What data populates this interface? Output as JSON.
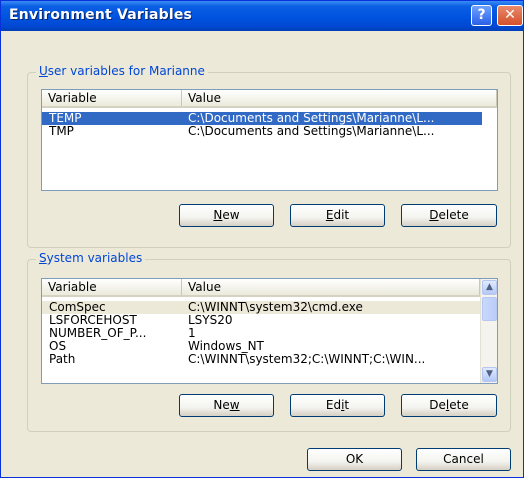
{
  "window": {
    "title": "Environment Variables",
    "help_glyph": "?",
    "close_glyph": "✕"
  },
  "user_group": {
    "label_prefix": "",
    "label_underline": "U",
    "label_rest": "ser variables for Marianne",
    "columns": [
      "Variable",
      "Value"
    ],
    "rows": [
      {
        "variable": "TEMP",
        "value": "C:\\Documents and Settings\\Marianne\\L..."
      },
      {
        "variable": "TMP",
        "value": "C:\\Documents and Settings\\Marianne\\L..."
      }
    ],
    "buttons": {
      "new": {
        "pre": "",
        "u": "N",
        "post": "ew"
      },
      "edit": {
        "pre": "",
        "u": "E",
        "post": "dit"
      },
      "delete": {
        "pre": "",
        "u": "D",
        "post": "elete"
      }
    }
  },
  "system_group": {
    "label_prefix": "",
    "label_underline": "S",
    "label_rest": "ystem variables",
    "columns": [
      "Variable",
      "Value"
    ],
    "rows": [
      {
        "variable": "ComSpec",
        "value": "C:\\WINNT\\system32\\cmd.exe"
      },
      {
        "variable": "LSFORCEHOST",
        "value": "LSYS20"
      },
      {
        "variable": "NUMBER_OF_P...",
        "value": "1"
      },
      {
        "variable": "OS",
        "value": "Windows_NT"
      },
      {
        "variable": "Path",
        "value": "C:\\WINNT\\system32;C:\\WINNT;C:\\WIN..."
      }
    ],
    "buttons": {
      "new": {
        "pre": "Ne",
        "u": "w",
        "post": ""
      },
      "edit": {
        "pre": "Ed",
        "u": "i",
        "post": "t"
      },
      "delete": {
        "pre": "De",
        "u": "l",
        "post": "ete"
      }
    }
  },
  "footer": {
    "ok": "OK",
    "cancel": "Cancel"
  }
}
